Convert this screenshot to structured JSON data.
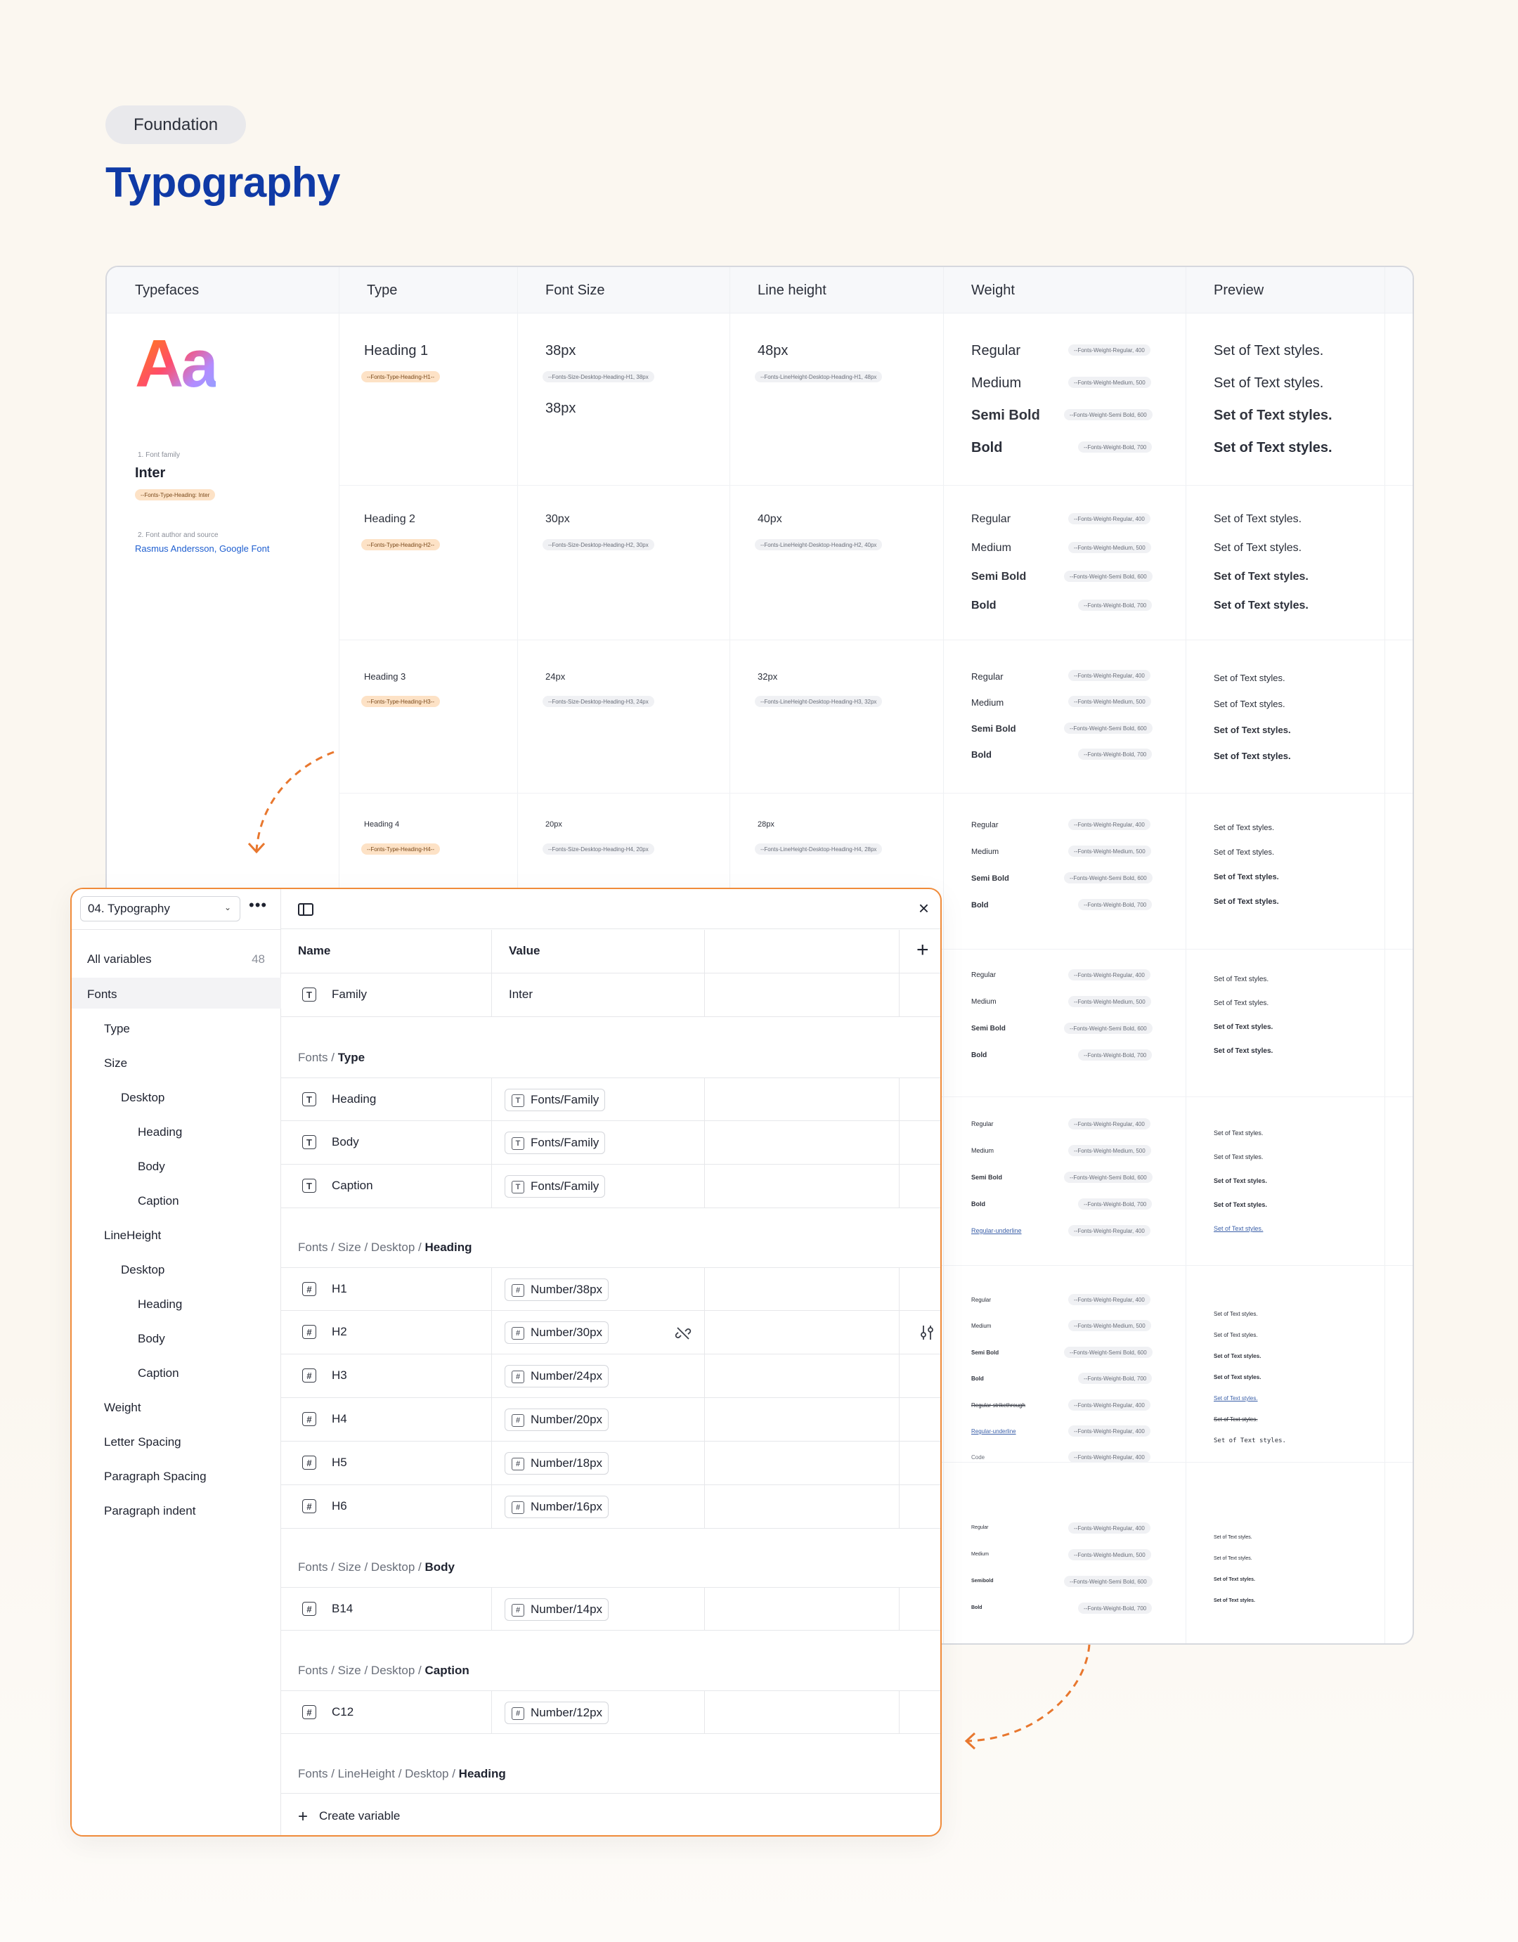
{
  "header": {
    "badge": "Foundation",
    "title": "Typography"
  },
  "table": {
    "columns": [
      "Typefaces",
      "Type",
      "Font Size",
      "Line height",
      "Weight",
      "Preview"
    ],
    "typeface": {
      "specimen": "Aa",
      "family_label": "1. Font family",
      "family": "Inter",
      "family_token": "--Fonts-Type-Heading: Inter",
      "author_label": "2. Font author and source",
      "author": "Rasmus Andersson, Google Font"
    },
    "rows": [
      {
        "type": "Heading 1",
        "type_token": "--Fonts-Type-Heading-H1--",
        "size": "38px",
        "size_token": "--Fonts-Size-Desktop-Heading-H1, 38px",
        "size_extra": "38px",
        "line": "48px",
        "line_token": "--Fonts-LineHeight-Desktop-Heading-H1, 48px"
      },
      {
        "type": "Heading 2",
        "type_token": "--Fonts-Type-Heading-H2--",
        "size": "30px",
        "size_token": "--Fonts-Size-Desktop-Heading-H2, 30px",
        "line": "40px",
        "line_token": "--Fonts-LineHeight-Desktop-Heading-H2, 40px"
      },
      {
        "type": "Heading 3",
        "type_token": "--Fonts-Type-Heading-H3--",
        "size": "24px",
        "size_token": "--Fonts-Size-Desktop-Heading-H3, 24px",
        "line": "32px",
        "line_token": "--Fonts-LineHeight-Desktop-Heading-H3, 32px"
      },
      {
        "type": "Heading 4",
        "type_token": "--Fonts-Type-Heading-H4--",
        "size": "20px",
        "size_token": "--Fonts-Size-Desktop-Heading-H4, 20px",
        "line": "28px",
        "line_token": "--Fonts-LineHeight-Desktop-Heading-H4, 28px"
      }
    ],
    "weight_tokens": {
      "regular": "--Fonts-Weight-Regular, 400",
      "medium": "--Fonts-Weight-Medium, 500",
      "semibold": "--Fonts-Weight-Semi Bold, 600",
      "bold": "--Fonts-Weight-Bold, 700"
    },
    "weight_labels": {
      "regular": "Regular",
      "medium": "Medium",
      "semibold": "Semi Bold",
      "semibold_alt": "Semibold",
      "bold": "Bold",
      "regular_underline": "Regular-underline",
      "regular_strike": "Regular-strikethrough",
      "code": "Code"
    },
    "preview_text": "Set of Text styles."
  },
  "panel": {
    "collection": "04. Typography",
    "all_variables": "All variables",
    "count": "48",
    "sidebar": [
      {
        "label": "Fonts",
        "level": 0
      },
      {
        "label": "Type",
        "level": 1
      },
      {
        "label": "Size",
        "level": 1
      },
      {
        "label": "Desktop",
        "level": 2
      },
      {
        "label": "Heading",
        "level": 3
      },
      {
        "label": "Body",
        "level": 3
      },
      {
        "label": "Caption",
        "level": 3
      },
      {
        "label": "LineHeight",
        "level": 1
      },
      {
        "label": "Desktop",
        "level": 2
      },
      {
        "label": "Heading",
        "level": 3
      },
      {
        "label": "Body",
        "level": 3
      },
      {
        "label": "Caption",
        "level": 3
      },
      {
        "label": "Weight",
        "level": 1
      },
      {
        "label": "Letter Spacing",
        "level": 1
      },
      {
        "label": "Paragraph Spacing",
        "level": 1
      },
      {
        "label": "Paragraph indent",
        "level": 1
      }
    ],
    "columns": {
      "name": "Name",
      "value": "Value"
    },
    "family_row": {
      "name": "Family",
      "value": "Inter"
    },
    "groups": [
      {
        "prefix": "Fonts / ",
        "leaf": "Type"
      },
      {
        "prefix": "Fonts / Size / Desktop / ",
        "leaf": "Heading"
      },
      {
        "prefix": "Fonts / Size / Desktop / ",
        "leaf": "Body"
      },
      {
        "prefix": "Fonts / Size / Desktop / ",
        "leaf": "Caption"
      },
      {
        "prefix": "Fonts / LineHeight / Desktop / ",
        "leaf": "Heading"
      }
    ],
    "type_rows": [
      {
        "name": "Heading",
        "value": "Fonts/Family"
      },
      {
        "name": "Body",
        "value": "Fonts/Family"
      },
      {
        "name": "Caption",
        "value": "Fonts/Family"
      }
    ],
    "heading_rows": [
      {
        "name": "H1",
        "value": "Number/38px"
      },
      {
        "name": "H2",
        "value": "Number/30px"
      },
      {
        "name": "H3",
        "value": "Number/24px"
      },
      {
        "name": "H4",
        "value": "Number/20px"
      },
      {
        "name": "H5",
        "value": "Number/18px"
      },
      {
        "name": "H6",
        "value": "Number/16px"
      }
    ],
    "body_rows": [
      {
        "name": "B14",
        "value": "Number/14px"
      }
    ],
    "caption_rows": [
      {
        "name": "C12",
        "value": "Number/12px"
      }
    ],
    "create_label": "Create variable",
    "icons": {
      "text_type": "T",
      "number_type": "#",
      "plus": "+",
      "close": "×",
      "unlink": "unlink-icon",
      "adjust": "sliders-icon"
    }
  }
}
